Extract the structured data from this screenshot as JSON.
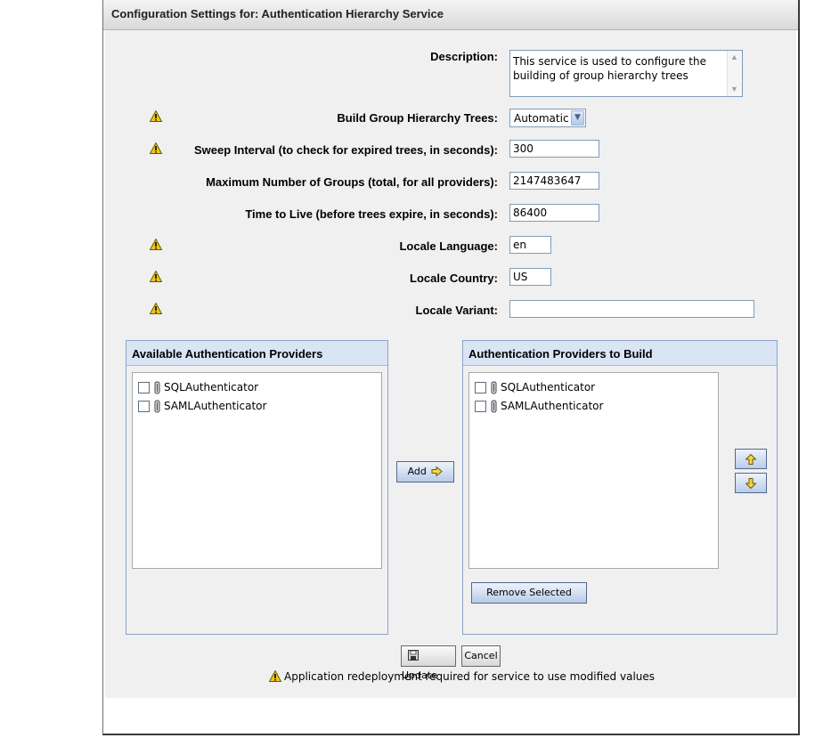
{
  "title": "Configuration Settings for: Authentication Hierarchy Service",
  "description": {
    "label": "Description:",
    "value": "This service is used to configure the building of group hierarchy trees"
  },
  "fields": {
    "build_group": {
      "label": "Build Group Hierarchy Trees:",
      "value": "Automatic"
    },
    "sweep_interval": {
      "label": "Sweep Interval (to check for expired trees, in seconds):",
      "value": "300"
    },
    "max_groups": {
      "label": "Maximum Number of Groups (total, for all providers):",
      "value": "2147483647"
    },
    "ttl": {
      "label": "Time to Live (before trees expire, in seconds):",
      "value": "86400"
    },
    "locale_language": {
      "label": "Locale Language:",
      "value": "en"
    },
    "locale_country": {
      "label": "Locale Country:",
      "value": "US"
    },
    "locale_variant": {
      "label": "Locale Variant:",
      "value": ""
    }
  },
  "available_panel": {
    "title": "Available Authentication Providers",
    "items": [
      "SQLAuthenticator",
      "SAMLAuthenticator"
    ]
  },
  "build_panel": {
    "title": "Authentication Providers to Build",
    "items": [
      "SQLAuthenticator",
      "SAMLAuthenticator"
    ]
  },
  "buttons": {
    "add": "Add",
    "remove_selected": "Remove Selected",
    "update": "Update",
    "cancel": "Cancel"
  },
  "footnote": "Application redeployment required for service to use modified values",
  "icons": {
    "warning": "warning-icon",
    "provider": "provider-icon",
    "arrow_right": "arrow-right-icon",
    "arrow_up": "arrow-up-icon",
    "arrow_down": "arrow-down-icon",
    "save": "save-icon"
  },
  "colors": {
    "panel_header": "#d9e4f5",
    "content_bg": "#f0f0f0",
    "warning": "#f2c51c"
  }
}
